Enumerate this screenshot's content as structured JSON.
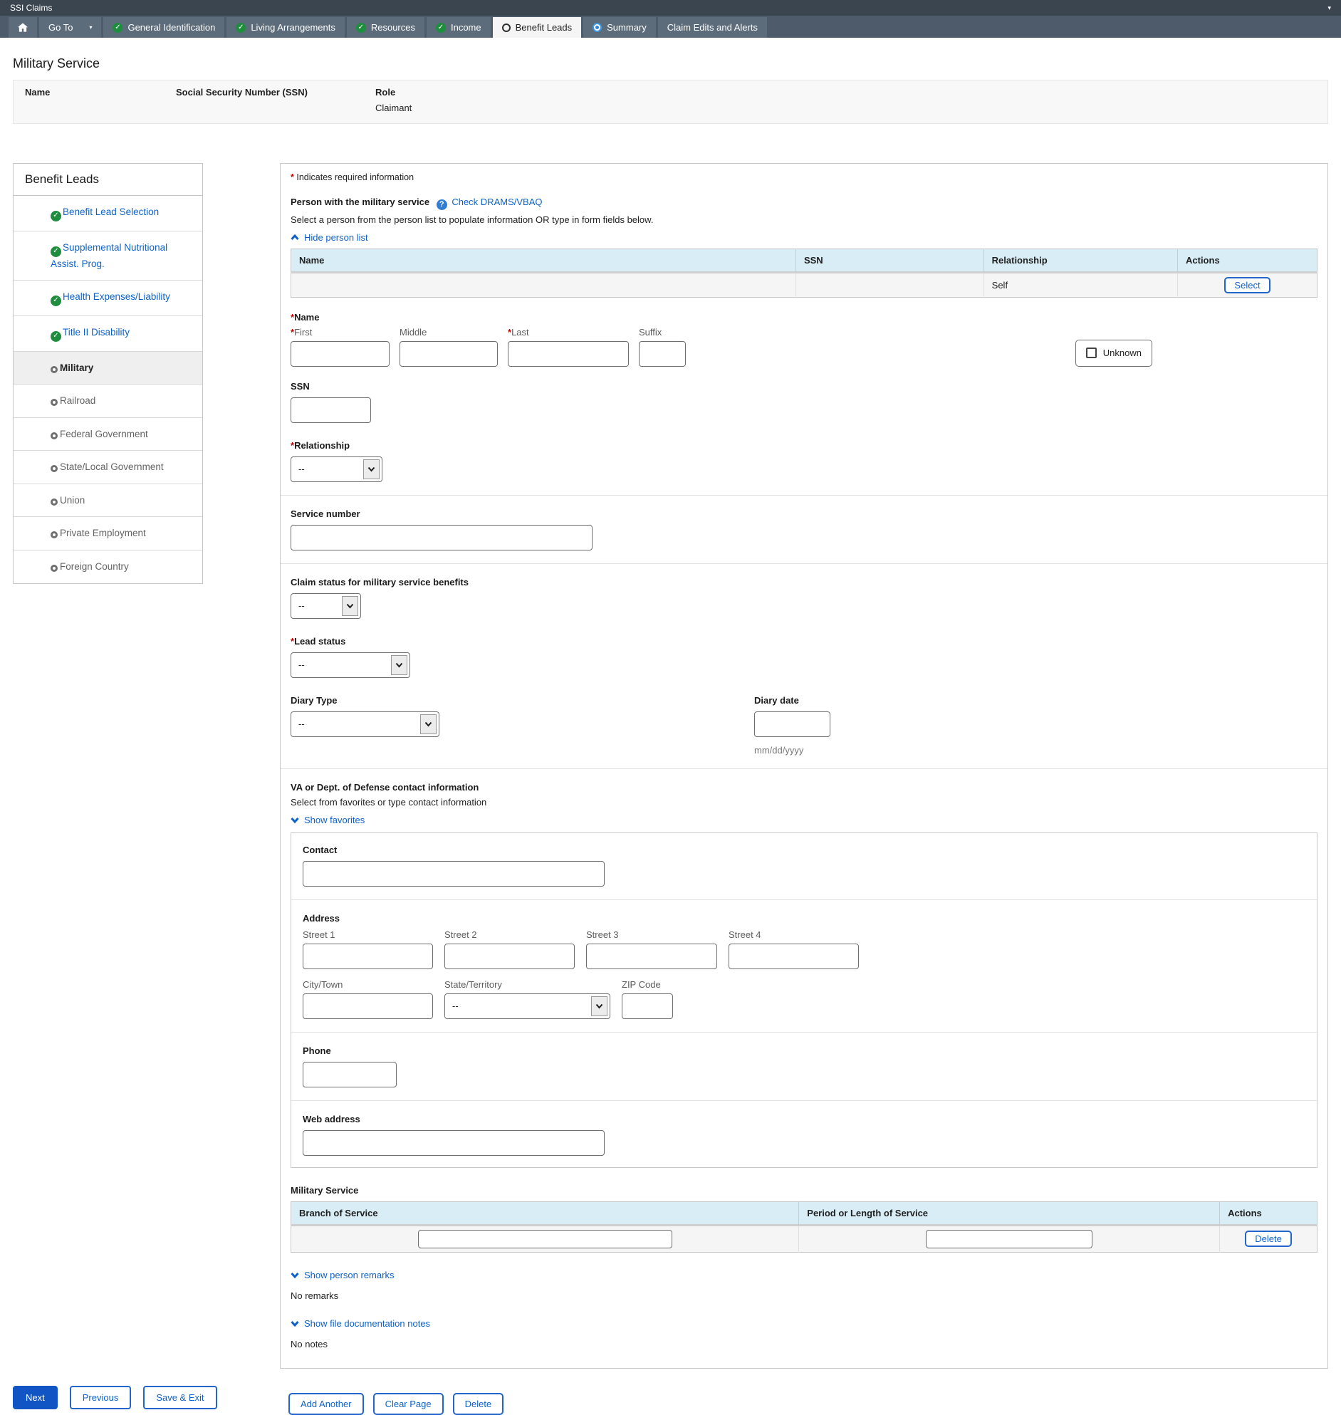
{
  "colors": {
    "accent_blue": "#0d62c9",
    "topbar_bg": "#3a4550",
    "navbar_bg": "#4d5b6a",
    "nav_button_bg": "#5d6c7b",
    "active_tab_bg": "#f5f5f5",
    "complete_green": "#1e8e3e",
    "table_header_bg": "#d9edf7",
    "required_red": "#c00000"
  },
  "topbar": {
    "title": "SSI Claims",
    "menu_caret": "▾"
  },
  "nav": {
    "go_to_label": "Go To",
    "go_to_caret": "▾",
    "tabs": [
      {
        "label": "General Identification",
        "status": "complete"
      },
      {
        "label": "Living Arrangements",
        "status": "complete"
      },
      {
        "label": "Resources",
        "status": "complete"
      },
      {
        "label": "Income",
        "status": "complete"
      },
      {
        "label": "Benefit Leads",
        "status": "active"
      },
      {
        "label": "Summary",
        "status": "in-progress"
      },
      {
        "label": "Claim Edits and Alerts",
        "status": "none"
      }
    ]
  },
  "page": {
    "title": "Military Service"
  },
  "person_header": {
    "name_label": "Name",
    "ssn_label": "Social Security Number (SSN)",
    "role_label": "Role",
    "role_value": "Claimant"
  },
  "sidebar": {
    "title": "Benefit Leads",
    "items": [
      {
        "label": "Benefit Lead Selection",
        "status": "complete"
      },
      {
        "label": "Supplemental Nutritional Assist. Prog.",
        "status": "complete"
      },
      {
        "label": "Health Expenses/Liability",
        "status": "complete"
      },
      {
        "label": "Title II Disability",
        "status": "complete"
      },
      {
        "label": "Military",
        "status": "active"
      },
      {
        "label": "Railroad",
        "status": "pending"
      },
      {
        "label": "Federal Government",
        "status": "pending"
      },
      {
        "label": "State/Local Government",
        "status": "pending"
      },
      {
        "label": "Union",
        "status": "pending"
      },
      {
        "label": "Private Employment",
        "status": "pending"
      },
      {
        "label": "Foreign Country",
        "status": "pending"
      }
    ]
  },
  "form": {
    "asterisk": "*",
    "required_note": "Indicates required information",
    "person": {
      "heading": "Person with the military service",
      "help_icon": "?",
      "check_link": "Check DRAMS/VBAQ",
      "subtext": "Select a person from the person list to populate information OR type in form fields below.",
      "toggle": "Hide person list"
    },
    "person_table": {
      "headers": [
        "Name",
        "SSN",
        "Relationship",
        "Actions"
      ],
      "row": {
        "name": "",
        "ssn": "",
        "relationship": "Self",
        "action": "Select"
      }
    },
    "name": {
      "section_label": "Name",
      "first": "First",
      "middle": "Middle",
      "last": "Last",
      "suffix": "Suffix",
      "unknown": "Unknown"
    },
    "ssn_label": "SSN",
    "relationship": {
      "label": "Relationship",
      "value": "--"
    },
    "service_number_label": "Service number",
    "claim_status": {
      "label": "Claim status for military service benefits",
      "value": "--"
    },
    "lead_status": {
      "label": "Lead status",
      "value": "--"
    },
    "diary": {
      "type_label": "Diary Type",
      "type_value": "--",
      "date_label": "Diary date",
      "date_format": "mm/dd/yyyy"
    },
    "va": {
      "heading": "VA or Dept. of Defense contact information",
      "subtext": "Select from favorites or type contact information",
      "toggle": "Show favorites",
      "contact_label": "Contact",
      "address_label": "Address",
      "street1": "Street 1",
      "street2": "Street 2",
      "street3": "Street 3",
      "street4": "Street 4",
      "city": "City/Town",
      "state_label": "State/Territory",
      "state_value": "--",
      "zip": "ZIP Code",
      "phone_label": "Phone",
      "web_label": "Web address"
    },
    "military": {
      "section_label": "Military Service",
      "headers": [
        "Branch of Service",
        "Period or Length of Service",
        "Actions"
      ],
      "delete_label": "Delete"
    },
    "remarks": {
      "toggle": "Show person remarks",
      "empty": "No remarks"
    },
    "notes": {
      "toggle": "Show file documentation notes",
      "empty": "No notes"
    },
    "actions": {
      "add": "Add Another",
      "clear": "Clear Page",
      "delete": "Delete"
    }
  },
  "footer": {
    "next": "Next",
    "previous": "Previous",
    "save_exit": "Save & Exit"
  }
}
